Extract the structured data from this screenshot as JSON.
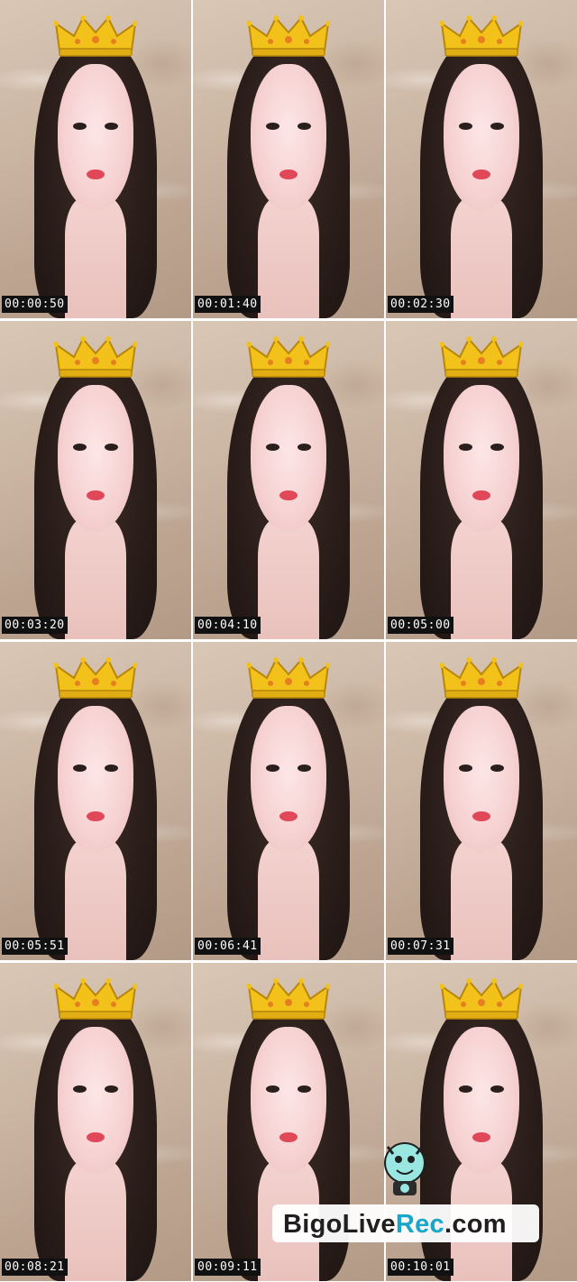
{
  "tiles": [
    {
      "timestamp": "00:00:50"
    },
    {
      "timestamp": "00:01:40"
    },
    {
      "timestamp": "00:02:30"
    },
    {
      "timestamp": "00:03:20"
    },
    {
      "timestamp": "00:04:10"
    },
    {
      "timestamp": "00:05:00"
    },
    {
      "timestamp": "00:05:51"
    },
    {
      "timestamp": "00:06:41"
    },
    {
      "timestamp": "00:07:31"
    },
    {
      "timestamp": "00:08:21"
    },
    {
      "timestamp": "00:09:11"
    },
    {
      "timestamp": "00:10:01"
    }
  ],
  "watermark": {
    "prefix": "BigoLive",
    "accent": "Rec",
    "suffix": ".com"
  },
  "colors": {
    "crown": "#f2c21b",
    "lips": "#e0485a",
    "hair": "#2a1d19",
    "stamp_bg": "#111111",
    "watermark_accent": "#1aa6c9"
  },
  "icons": [
    "crown-icon",
    "bigo-mascot-icon"
  ]
}
